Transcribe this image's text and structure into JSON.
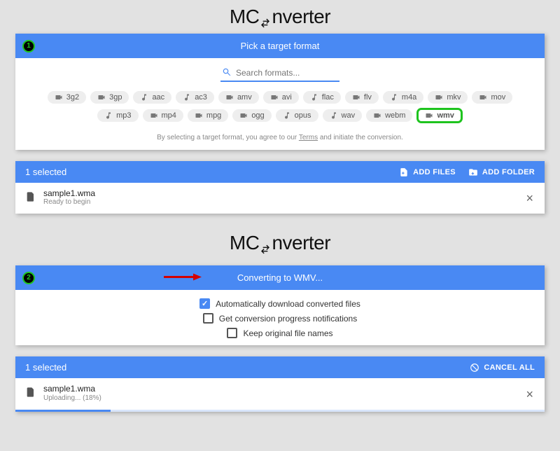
{
  "brand": {
    "part1": "MC",
    "part2": "nverter"
  },
  "step1": {
    "badge": "1",
    "title": "Pick a target format",
    "search_placeholder": "Search formats...",
    "formats": [
      {
        "name": "3g2",
        "kind": "video"
      },
      {
        "name": "3gp",
        "kind": "video"
      },
      {
        "name": "aac",
        "kind": "audio"
      },
      {
        "name": "ac3",
        "kind": "audio"
      },
      {
        "name": "amv",
        "kind": "video"
      },
      {
        "name": "avi",
        "kind": "video"
      },
      {
        "name": "flac",
        "kind": "audio"
      },
      {
        "name": "flv",
        "kind": "video"
      },
      {
        "name": "m4a",
        "kind": "audio"
      },
      {
        "name": "mkv",
        "kind": "video"
      },
      {
        "name": "mov",
        "kind": "video"
      },
      {
        "name": "mp3",
        "kind": "audio"
      },
      {
        "name": "mp4",
        "kind": "video"
      },
      {
        "name": "mpg",
        "kind": "video"
      },
      {
        "name": "ogg",
        "kind": "video"
      },
      {
        "name": "opus",
        "kind": "audio"
      },
      {
        "name": "wav",
        "kind": "audio"
      },
      {
        "name": "webm",
        "kind": "video"
      },
      {
        "name": "wmv",
        "kind": "video",
        "selected": true
      }
    ],
    "disclaimer_pre": "By selecting a target format, you agree to our ",
    "disclaimer_link": "Terms",
    "disclaimer_post": " and initiate the conversion.",
    "selected_label": "1 selected",
    "buttons": {
      "add_files": "ADD FILES",
      "add_folder": "ADD FOLDER"
    },
    "file": {
      "name": "sample1.wma",
      "status": "Ready to begin"
    }
  },
  "step2": {
    "badge": "2",
    "title": "Converting to WMV...",
    "options": [
      {
        "label": "Automatically download converted files",
        "checked": true
      },
      {
        "label": "Get conversion progress notifications",
        "checked": false
      },
      {
        "label": "Keep original file names",
        "checked": false
      }
    ],
    "selected_label": "1 selected",
    "cancel_label": "CANCEL ALL",
    "file": {
      "name": "sample1.wma",
      "status": "Uploading... (18%)",
      "progress": 18
    }
  }
}
